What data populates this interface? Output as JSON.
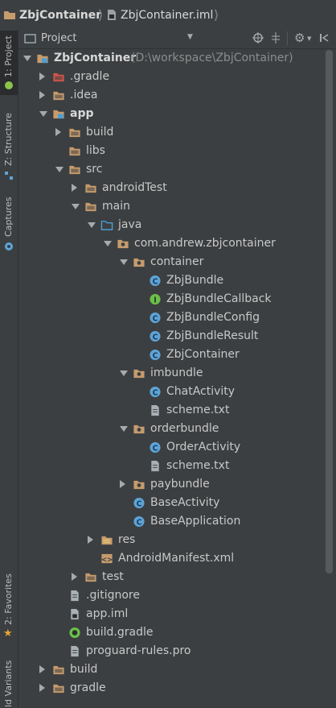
{
  "breadcrumb": {
    "project": "ZbjContainer",
    "file": "ZbjContainer.iml"
  },
  "tool_strip": {
    "project": "1: Project",
    "structure": "Z: Structure",
    "captures": "Captures",
    "favorites": "2: Favorites",
    "build_variants": "ld Variants"
  },
  "panel": {
    "title": "Project"
  },
  "tree": {
    "root_name": "ZbjContainer",
    "root_path": "(D:\\workspace\\ZbjContainer)",
    "items": [
      {
        "label": "ZbjContainer",
        "arrow": "open",
        "icon": "module-folder",
        "depth": 0,
        "bold": true
      },
      {
        "label": ".gradle",
        "arrow": "closed",
        "icon": "folder-red",
        "depth": 1
      },
      {
        "label": ".idea",
        "arrow": "closed",
        "icon": "folder",
        "depth": 1
      },
      {
        "label": "app",
        "arrow": "open",
        "icon": "module-folder",
        "depth": 1,
        "bold": true
      },
      {
        "label": "build",
        "arrow": "closed",
        "icon": "folder",
        "depth": 2
      },
      {
        "label": "libs",
        "arrow": "none",
        "icon": "folder",
        "depth": 2
      },
      {
        "label": "src",
        "arrow": "open",
        "icon": "folder",
        "depth": 2
      },
      {
        "label": "androidTest",
        "arrow": "closed",
        "icon": "folder",
        "depth": 3
      },
      {
        "label": "main",
        "arrow": "open",
        "icon": "folder",
        "depth": 3
      },
      {
        "label": "java",
        "arrow": "open",
        "icon": "source-folder",
        "depth": 4
      },
      {
        "label": "com.andrew.zbjcontainer",
        "arrow": "open",
        "icon": "package",
        "depth": 5
      },
      {
        "label": "container",
        "arrow": "open",
        "icon": "package",
        "depth": 6
      },
      {
        "label": "ZbjBundle",
        "arrow": "none",
        "icon": "class",
        "depth": 7
      },
      {
        "label": "ZbjBundleCallback",
        "arrow": "none",
        "icon": "interface",
        "depth": 7
      },
      {
        "label": "ZbjBundleConfig",
        "arrow": "none",
        "icon": "class",
        "depth": 7
      },
      {
        "label": "ZbjBundleResult",
        "arrow": "none",
        "icon": "class",
        "depth": 7
      },
      {
        "label": "ZbjContainer",
        "arrow": "none",
        "icon": "class",
        "depth": 7
      },
      {
        "label": "imbundle",
        "arrow": "open",
        "icon": "package",
        "depth": 6
      },
      {
        "label": "ChatActivity",
        "arrow": "none",
        "icon": "class",
        "depth": 7
      },
      {
        "label": "scheme.txt",
        "arrow": "none",
        "icon": "text-file",
        "depth": 7
      },
      {
        "label": "orderbundle",
        "arrow": "open",
        "icon": "package",
        "depth": 6
      },
      {
        "label": "OrderActivity",
        "arrow": "none",
        "icon": "class",
        "depth": 7
      },
      {
        "label": "scheme.txt",
        "arrow": "none",
        "icon": "text-file",
        "depth": 7
      },
      {
        "label": "paybundle",
        "arrow": "closed",
        "icon": "package",
        "depth": 6
      },
      {
        "label": "BaseActivity",
        "arrow": "none",
        "icon": "class",
        "depth": 6
      },
      {
        "label": "BaseApplication",
        "arrow": "none",
        "icon": "class",
        "depth": 6
      },
      {
        "label": "res",
        "arrow": "closed",
        "icon": "resource-folder",
        "depth": 4
      },
      {
        "label": "AndroidManifest.xml",
        "arrow": "none",
        "icon": "xml-file",
        "depth": 4
      },
      {
        "label": "test",
        "arrow": "closed",
        "icon": "folder",
        "depth": 3
      },
      {
        "label": ".gitignore",
        "arrow": "none",
        "icon": "text-file",
        "depth": 2
      },
      {
        "label": "app.iml",
        "arrow": "none",
        "icon": "iml-file",
        "depth": 2
      },
      {
        "label": "build.gradle",
        "arrow": "none",
        "icon": "gradle-file",
        "depth": 2
      },
      {
        "label": "proguard-rules.pro",
        "arrow": "none",
        "icon": "text-file",
        "depth": 2
      },
      {
        "label": "build",
        "arrow": "closed",
        "icon": "folder",
        "depth": 1
      },
      {
        "label": "gradle",
        "arrow": "closed",
        "icon": "folder",
        "depth": 1
      }
    ]
  },
  "colors": {
    "background": "#3c3f41",
    "folder": "#c69c6d",
    "folder_red": "#d0554b",
    "package": "#c69c6d",
    "source_folder": "#4a9fd5",
    "class": "#5da4d8",
    "text": "#c8c8c8"
  }
}
